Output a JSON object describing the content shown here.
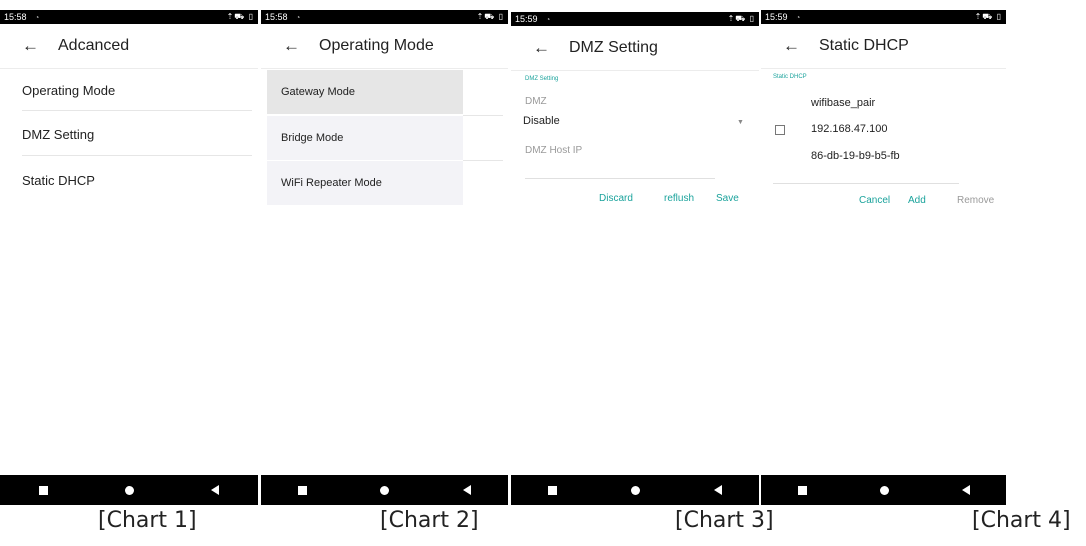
{
  "screens": [
    {
      "status_time": "15:58",
      "status_icons": "⇡⛟ ▯",
      "title": "Adcanced",
      "items": [
        "Operating Mode",
        "DMZ Setting",
        "Static DHCP"
      ]
    },
    {
      "status_time": "15:58",
      "status_icons": "⇡⛟ ▯",
      "title": "Operating Mode",
      "modes": [
        "Gateway Mode",
        "Bridge Mode",
        "WiFi Repeater Mode"
      ]
    },
    {
      "status_time": "15:59",
      "status_icons": "⇡⛟ ▯",
      "title": "DMZ Setting",
      "section_label": "DMZ Setting",
      "dmz_label": "DMZ",
      "dmz_value": "Disable",
      "host_ip_label": "DMZ Host IP",
      "actions": {
        "discard": "Discard",
        "reflush": "reflush",
        "save": "Save"
      }
    },
    {
      "status_time": "15:59",
      "status_icons": "⇡⛟ ▯",
      "title": "Static DHCP",
      "section_label": "Static DHCP",
      "entry": {
        "name": "wifibase_pair",
        "ip": "192.168.47.100",
        "mac": "86-db-19-b9-b5-fb",
        "checked": false
      },
      "actions": {
        "cancel": "Cancel",
        "add": "Add",
        "remove": "Remove"
      }
    }
  ],
  "captions": [
    "[Chart 1]",
    "[Chart 2]",
    "[Chart 3]",
    "[Chart 4]"
  ],
  "colors": {
    "accent": "#1ba39c",
    "bars": "#000000"
  },
  "icons": {
    "back": "arrow-left-icon",
    "nav": [
      "square-icon",
      "circle-icon",
      "triangle-back-icon"
    ]
  }
}
